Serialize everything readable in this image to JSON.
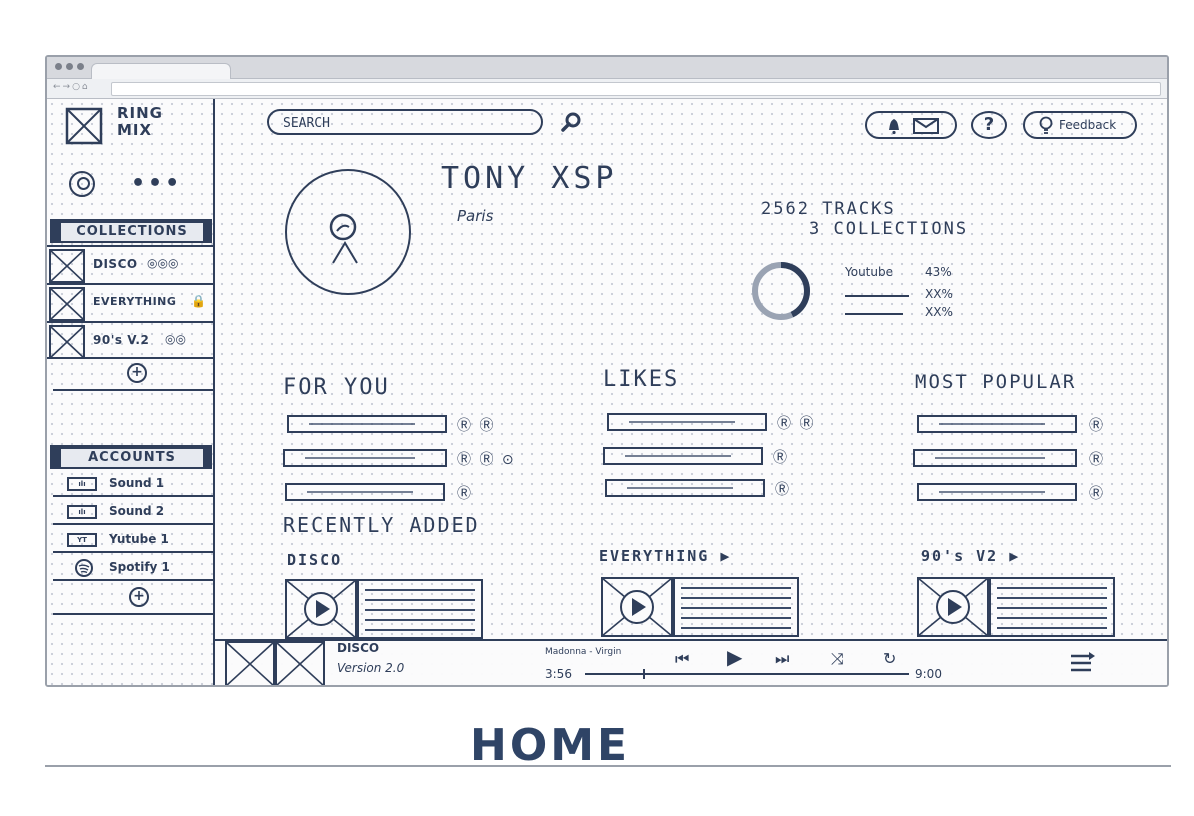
{
  "app": {
    "logo_text": "RING MIX"
  },
  "sidebar": {
    "collections_header": "COLLECTIONS",
    "collections": [
      {
        "label": "DISCO",
        "icons": "◎◎◎"
      },
      {
        "label": "EVERYTHING",
        "icons": "🔒"
      },
      {
        "label": "90's V.2",
        "icons": "◎◎"
      }
    ],
    "accounts_header": "ACCOUNTS",
    "accounts": [
      {
        "badge": "ılı",
        "label": "Sound 1"
      },
      {
        "badge": "ılı",
        "label": "Sound 2"
      },
      {
        "badge": "YT",
        "label": "Yutube 1"
      },
      {
        "badge": "",
        "label": "Spotify 1"
      }
    ]
  },
  "header": {
    "search_placeholder": "SEARCH",
    "help_label": "?",
    "feedback_label": "Feedback"
  },
  "profile": {
    "name": "TONY XSP",
    "city": "Paris",
    "tracks_stat": "2562 TRACKS",
    "collections_stat": "3 COLLECTIONS",
    "breakdown": [
      {
        "label": "Youtube",
        "value": "43%"
      },
      {
        "label": "",
        "value": "XX%"
      },
      {
        "label": "",
        "value": "XX%"
      }
    ],
    "donut_fraction": 0.43
  },
  "sections": {
    "for_you": "FOR YOU",
    "likes": "LIKES",
    "most_popular": "MOST POPULAR",
    "recently_added": "RECENTLY ADDED"
  },
  "recent": [
    {
      "title": "DISCO"
    },
    {
      "title": "EVERYTHING ▶"
    },
    {
      "title": "90's V2 ▶"
    }
  ],
  "player": {
    "now_playing_title": "DISCO",
    "now_playing_sub": "Version 2.0",
    "track_name": "Madonna - Virgin",
    "time_current": "3:56",
    "time_total": "9:00",
    "progress_fraction": 0.18
  },
  "page": {
    "title": "HOME"
  }
}
